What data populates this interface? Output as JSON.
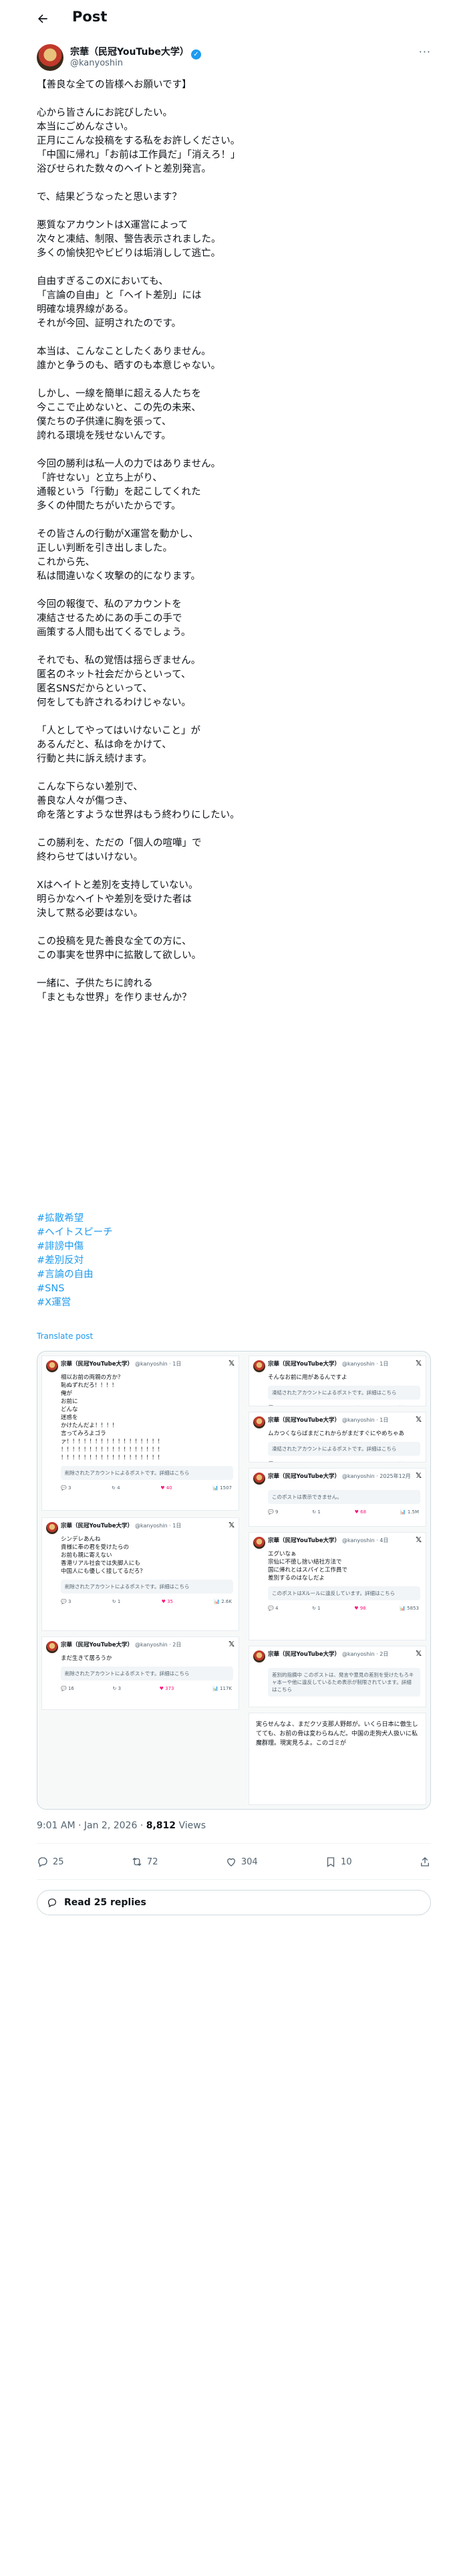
{
  "header": {
    "title": "Post"
  },
  "author": {
    "name": "宗華（民冠YouTube大学）",
    "handle": "@kanyoshin"
  },
  "post": {
    "paragraphs": [
      "【善良な全ての皆様へお願いです】",
      "心から皆さんにお詫びしたい。\n本当にごめんなさい。\n正月にこんな投稿をする私をお許しください。\n「中国に帰れ」「お前は工作員だ」「消えろ！」\n浴びせられた数々のヘイトと差別発言。",
      "で、結果どうなったと思います？",
      "悪質なアカウントはX運営によって\n次々と凍結、制限、警告表示されました。\n多くの愉快犯やビビりは垢消しして逃亡。",
      "自由すぎるこのXにおいても、\n「言論の自由」と「ヘイト差別」には\n明確な境界線がある。\nそれが今回、証明されたのです。",
      "本当は、こんなことしたくありません。\n誰かと争うのも、晒すのも本意じゃない。",
      "しかし、一線を簡単に超える人たちを\n今ここで止めないと、この先の未来、\n僕たちの子供達に胸を張って、\n誇れる環境を残せないんです。",
      "今回の勝利は私一人の力ではありません。\n「許せない」と立ち上がり、\n通報という「行動」を起こしてくれた\n多くの仲間たちがいたからです。",
      "その皆さんの行動がX運営を動かし、\n正しい判断を引き出しました。\nこれから先、\n私は間違いなく攻撃の的になります。",
      "今回の報復で、私のアカウントを\n凍結させるためにあの手この手で\n画策する人間も出てくるでしょう。",
      "それでも、私の覚悟は揺らぎません。\n匿名のネット社会だからといって、\n匿名SNSだからといって、\n何をしても許されるわけじゃない。",
      "「人としてやってはいけないこと」が\nあるんだと、私は命をかけて、\n行動と共に訴え続けます。",
      "こんな下らない差別で、\n善良な人々が傷つき、\n命を落とすような世界はもう終わりにしたい。",
      "この勝利を、ただの「個人の喧嘩」で\n終わらせてはいけない。",
      "Xはヘイトと差別を支持していない。\n明らかなヘイトや差別を受けた者は\n決して黙る必要はない。",
      "この投稿を見た善良な全ての方に、\nこの事実を世界中に拡散して欲しい。",
      "一緒に、子供たちに誇れる\n「まともな世界」を作りませんか？"
    ],
    "hashtags": [
      "#拡散希望",
      "#ヘイトスピーチ",
      "#誹謗中傷",
      "#差別反対",
      "#言論の自由",
      "#SNS",
      "#X運営"
    ],
    "translate_label": "Translate post"
  },
  "media": {
    "shot1": {
      "name": "宗華（民冠YouTube大学）",
      "handle": "@kanyoshin · 1日",
      "text": "相以お前の両親の方か？\n恥ぬずれだろ！！！！\n俺が\nお前に\nどんな\n迷惑を\nかけたんだよ！！！！\n言ってみろよゴラ\nァ！！！！！！！！！！！！！！！！！\n！！！！！！！！！！！！！！！！！！\n！！！！！！！！！！！！！！！！！！",
      "notice": "削除されたアカウントによるポストです。詳細はこちら",
      "stats": [
        "3",
        "4",
        "40",
        "1507"
      ]
    },
    "shot2": {
      "name": "宗華（民冠YouTube大学）",
      "handle": "@kanyoshin · 1日",
      "text": "シンデレあんね\n貴様に奉の君を受けたらの\nお前も親に寄えない\n香港リアル社会では失脚人にも\n中国人にも優しく接してるだろ？",
      "notice": "削除されたアカウントによるポストです。詳細はこちら",
      "stats": [
        "3",
        "1",
        "35",
        "2.6K"
      ]
    },
    "shot3": {
      "name": "宗華（民冠YouTube大学）",
      "handle": "@kanyoshin · 2日",
      "text": "まだ生きて居ろうか",
      "notice": "削除されたアカウントによるポストです。詳細はこちら",
      "stats": [
        "16",
        "3",
        "373",
        "117K"
      ]
    },
    "shot4": {
      "name": "宗華（民冠YouTube大学）",
      "handle": "@kanyoshin · 1日",
      "text": "そんなお前に用があるんですよ",
      "notice": "凍結されたアカウントによるポストです。詳細はこちら",
      "stats": [
        "1",
        "1",
        "9",
        "1586"
      ]
    },
    "shot5": {
      "name": "宗華（民冠YouTube大学）",
      "handle": "@kanyoshin · 1日",
      "text": "ムカつくならばまだこれからがまだすぐにやめちゃあ",
      "notice": "凍結されたアカウントによるポストです。詳細はこちら",
      "stats": [
        "3",
        "1",
        "10",
        "1098"
      ]
    },
    "shot6": {
      "name": "宗華（民冠YouTube大学）",
      "handle": "@kanyoshin · 2025年12月",
      "text": "",
      "notice": "このポストは表示できません。",
      "stats": [
        "9",
        "1",
        "68",
        "1.5M"
      ]
    },
    "shot7": {
      "name": "宗華（民冠YouTube大学）",
      "handle": "@kanyoshin · 4日",
      "text": "エグいなぁ\n宗仙に不徳し捨い結社方法で\n国に帰れとはスパイと工作員で\n差別するのはなしだよ",
      "notice": "このポストはXルールに違反しています。詳細はこちら",
      "stats": [
        "4",
        "1",
        "98",
        "5853"
      ]
    },
    "shot8": {
      "name": "宗華（民冠YouTube大学）",
      "handle": "@kanyoshin · 2日",
      "text": "",
      "notice": "差別的指摘中 このポストは、発言や意見の差別を受けたもろキャ本ーや他に違反しているため表示が制限されています。詳細はこちら",
      "stats": []
    },
    "shot9": {
      "text": "実らせんなよ、まだクソ支那人野郎が。いくら日本に傲生してても、お前の骨は変わらねんだ。中国の走狗犬人扱いに私魔群理。現実見ろよ。このゴミが"
    }
  },
  "meta": {
    "time": "9:01 AM · Jan 2, 2026 · ",
    "views_count": "8,812",
    "views_label": " Views"
  },
  "actions": {
    "replies": "25",
    "reposts": "72",
    "likes": "304",
    "bookmarks": "10"
  },
  "read_replies": "Read 25 replies",
  "colors": {
    "accent": "#1d9bf0",
    "text": "#0f1419",
    "muted": "#536471",
    "border": "#cfd9de"
  }
}
